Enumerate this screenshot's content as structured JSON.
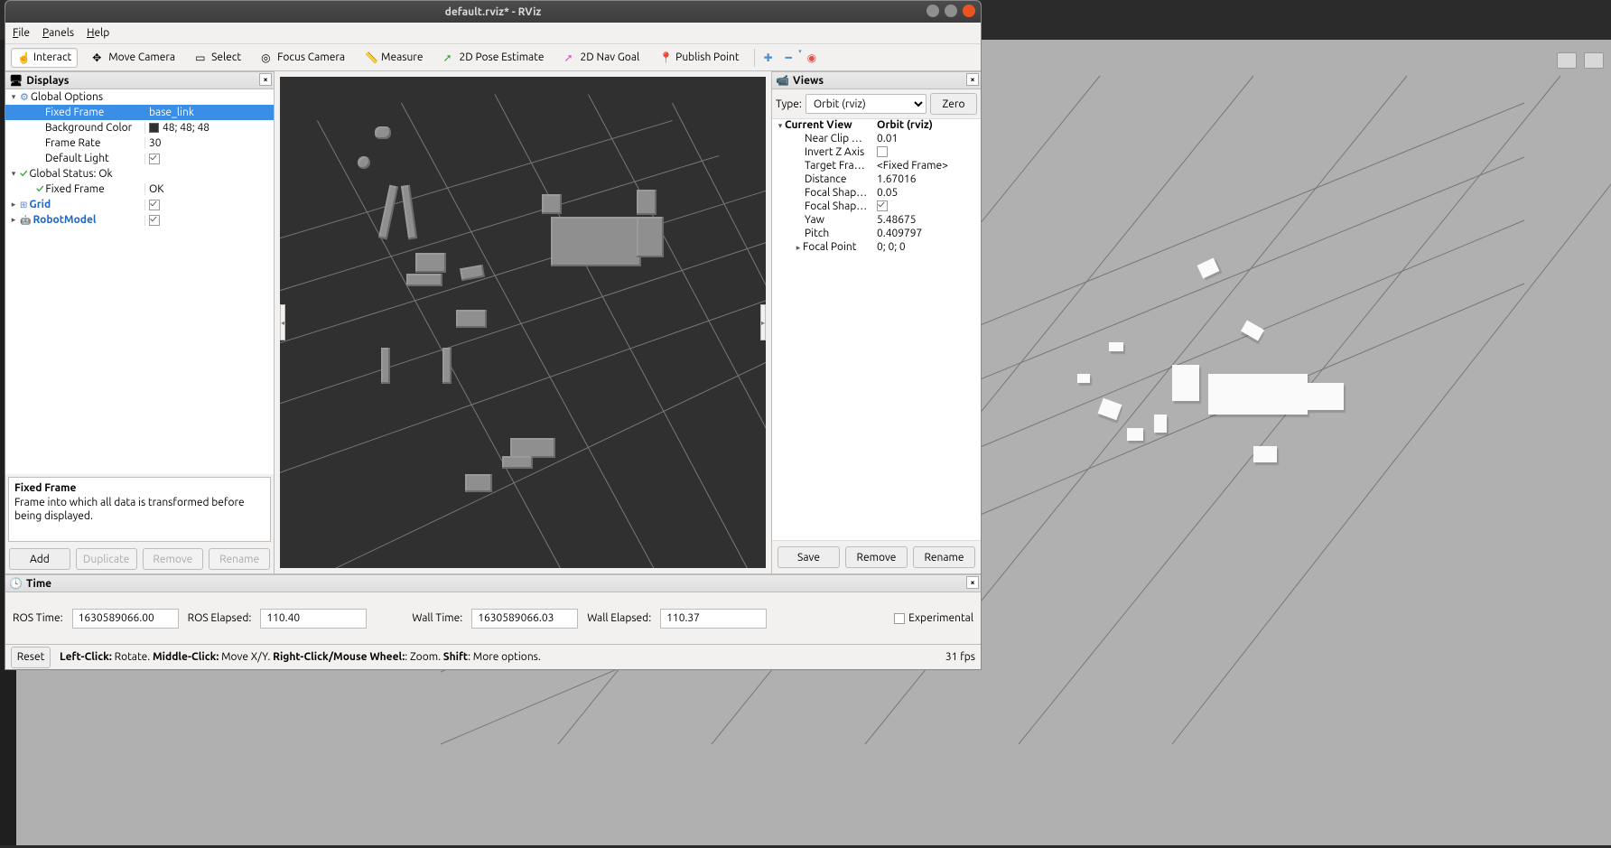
{
  "window": {
    "title": "default.rviz* - RViz"
  },
  "menubar": {
    "file": "File",
    "panels": "Panels",
    "help": "Help"
  },
  "toolbar": {
    "interact": "Interact",
    "move_camera": "Move Camera",
    "select": "Select",
    "focus_camera": "Focus Camera",
    "measure": "Measure",
    "pose_estimate": "2D Pose Estimate",
    "nav_goal": "2D Nav Goal",
    "publish_point": "Publish Point"
  },
  "displays": {
    "header": "Displays",
    "global_options": "Global Options",
    "fixed_frame_label": "Fixed Frame",
    "fixed_frame_value": "base_link",
    "background_color_label": "Background Color",
    "background_color_value": "48; 48; 48",
    "frame_rate_label": "Frame Rate",
    "frame_rate_value": "30",
    "default_light_label": "Default Light",
    "global_status_label": "Global Status: Ok",
    "gs_fixed_frame_label": "Fixed Frame",
    "gs_fixed_frame_value": "OK",
    "grid_label": "Grid",
    "robotmodel_label": "RobotModel",
    "desc_title": "Fixed Frame",
    "desc_body": "Frame into which all data is transformed before being displayed.",
    "add": "Add",
    "duplicate": "Duplicate",
    "remove": "Remove",
    "rename": "Rename"
  },
  "views": {
    "header": "Views",
    "type_label": "Type:",
    "type_value": "Orbit (rviz)",
    "zero": "Zero",
    "current_view": "Current View",
    "current_view_val": "Orbit (rviz)",
    "near_clip_label": "Near Clip …",
    "near_clip_val": "0.01",
    "invert_z_label": "Invert Z Axis",
    "target_frame_label": "Target Fra…",
    "target_frame_val": "<Fixed Frame>",
    "distance_label": "Distance",
    "distance_val": "1.67016",
    "focal_shape_s_label": "Focal Shap…",
    "focal_shape_s_val": "0.05",
    "focal_shape_f_label": "Focal Shap…",
    "yaw_label": "Yaw",
    "yaw_val": "5.48675",
    "pitch_label": "Pitch",
    "pitch_val": "0.409797",
    "focal_point_label": "Focal Point",
    "focal_point_val": "0; 0; 0",
    "save": "Save",
    "remove": "Remove",
    "rename": "Rename"
  },
  "time": {
    "header": "Time",
    "ros_time_label": "ROS Time:",
    "ros_time_val": "1630589066.00",
    "ros_elapsed_label": "ROS Elapsed:",
    "ros_elapsed_val": "110.40",
    "wall_time_label": "Wall Time:",
    "wall_time_val": "1630589066.03",
    "wall_elapsed_label": "Wall Elapsed:",
    "wall_elapsed_val": "110.37",
    "experimental": "Experimental"
  },
  "status": {
    "reset": "Reset",
    "hint_left": "Left-Click:",
    "hint_left_t": " Rotate. ",
    "hint_mid": "Middle-Click:",
    "hint_mid_t": " Move X/Y. ",
    "hint_right": "Right-Click/Mouse Wheel:",
    "hint_right_t": ": Zoom. ",
    "hint_shift": "Shift",
    "hint_shift_t": ": More options.",
    "fps": "31 fps"
  }
}
